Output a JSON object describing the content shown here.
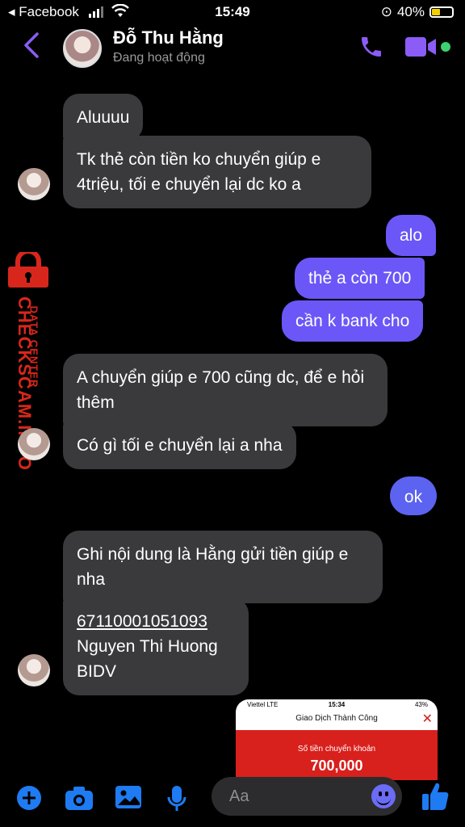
{
  "status_bar": {
    "back_app": "◂ Facebook",
    "time": "15:49",
    "battery": "40%",
    "battery_level": 0.4
  },
  "header": {
    "contact_name": "Đỗ Thu Hằng",
    "presence": "Đang hoạt động",
    "colors": {
      "accent": "#7b5cf5",
      "online": "#3bd16f"
    }
  },
  "messages": [
    {
      "side": "in",
      "text": "Aluuuu"
    },
    {
      "side": "in",
      "text": "Tk thẻ còn tiền ko chuyển giúp e 4triệu, tối e chuyển lại dc ko a"
    },
    {
      "side": "out",
      "text": "alo"
    },
    {
      "side": "out",
      "text": "thẻ a còn 700"
    },
    {
      "side": "out",
      "text": "cần k bank cho"
    },
    {
      "side": "in",
      "text": "A chuyển giúp e 700 cũng dc, để e hỏi thêm"
    },
    {
      "side": "in",
      "text": "Có gì tối e chuyển lại a nha"
    },
    {
      "side": "out",
      "text": "ok"
    },
    {
      "side": "in",
      "text": "Ghi nội dung là Hằng gửi tiền giúp e nha"
    },
    {
      "side": "in",
      "account_number": "67110001051093",
      "account_name": "Nguyen Thi Huong",
      "bank": "BIDV"
    }
  ],
  "watermark": {
    "brand": "CHECKSCAM.INFO",
    "tagline": "DATA CENTER"
  },
  "attachment": {
    "carrier": "Viettel  LTE",
    "time": "15:34",
    "battery": "43%",
    "title": "Giao Dịch Thành Công",
    "amount_label": "Số tiền chuyển khoản",
    "amount": "700,000"
  },
  "composer": {
    "placeholder": "Aa",
    "icons": [
      "plus-icon",
      "camera-icon",
      "photo-icon",
      "microphone-icon",
      "emoji-icon",
      "thumbs-up-icon"
    ]
  }
}
